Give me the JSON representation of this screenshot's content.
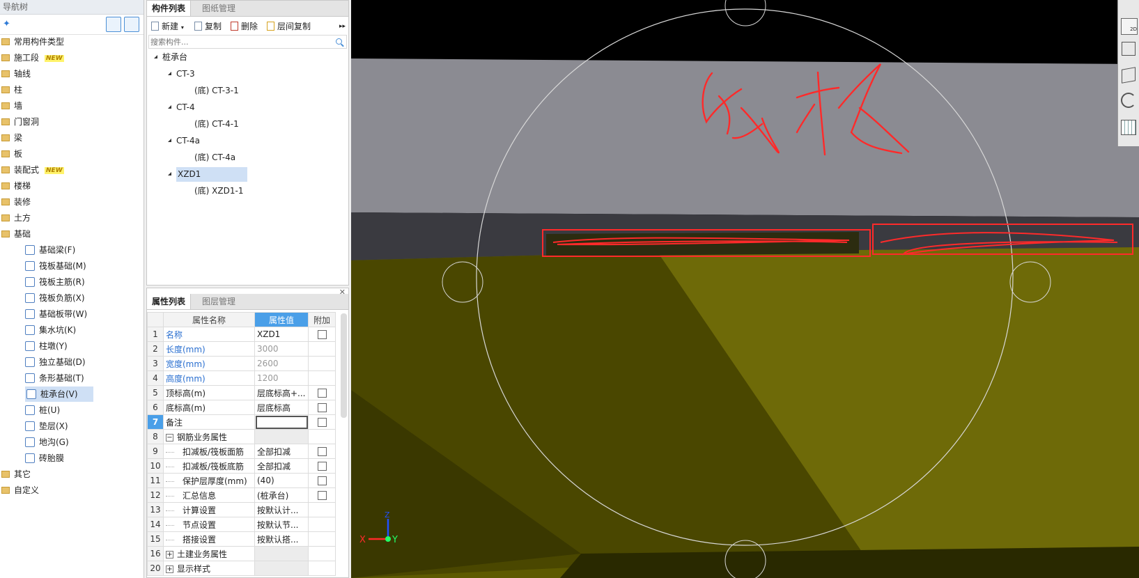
{
  "nav": {
    "title": "导航树",
    "new_badge": "NEW",
    "items": [
      {
        "label": "常用构件类型",
        "new": false
      },
      {
        "label": "施工段",
        "new": true
      },
      {
        "label": "轴线",
        "new": false
      },
      {
        "label": "柱",
        "new": false
      },
      {
        "label": "墙",
        "new": false
      },
      {
        "label": "门窗洞",
        "new": false
      },
      {
        "label": "梁",
        "new": false
      },
      {
        "label": "板",
        "new": false
      },
      {
        "label": "装配式",
        "new": true
      },
      {
        "label": "楼梯",
        "new": false
      },
      {
        "label": "装修",
        "new": false
      },
      {
        "label": "土方",
        "new": false
      },
      {
        "label": "基础",
        "new": false
      }
    ],
    "foundation_children": [
      "基础梁(F)",
      "筏板基础(M)",
      "筏板主筋(R)",
      "筏板负筋(X)",
      "基础板带(W)",
      "集水坑(K)",
      "柱墩(Y)",
      "独立基础(D)",
      "条形基础(T)",
      "桩承台(V)",
      "桩(U)",
      "垫层(X)",
      "地沟(G)",
      "砖胎膜"
    ],
    "tail_items": [
      "其它",
      "自定义"
    ]
  },
  "component_panel": {
    "tabs": [
      "构件列表",
      "图纸管理"
    ],
    "toolbar": {
      "new": "新建",
      "copy": "复制",
      "delete": "删除",
      "floor_copy": "层间复制"
    },
    "search_placeholder": "搜索构件...",
    "tree": {
      "root": "桩承台",
      "groups": [
        {
          "name": "CT-3",
          "child": "(底) CT-3-1"
        },
        {
          "name": "CT-4",
          "child": "(底) CT-4-1"
        },
        {
          "name": "CT-4a",
          "child": "(底) CT-4a"
        },
        {
          "name": "XZD1",
          "child": "(底) XZD1-1"
        }
      ]
    }
  },
  "property_panel": {
    "tabs": [
      "属性列表",
      "图层管理"
    ],
    "headers": {
      "name": "属性名称",
      "value": "属性值",
      "extra": "附加"
    },
    "rows": [
      {
        "no": "1",
        "name": "名称",
        "value": "XZD1",
        "blue": true
      },
      {
        "no": "2",
        "name": "长度(mm)",
        "value": "3000",
        "blue": true
      },
      {
        "no": "3",
        "name": "宽度(mm)",
        "value": "2600",
        "blue": true
      },
      {
        "no": "4",
        "name": "高度(mm)",
        "value": "1200",
        "blue": true
      },
      {
        "no": "5",
        "name": "顶标高(m)",
        "value": "层底标高+..."
      },
      {
        "no": "6",
        "name": "底标高(m)",
        "value": "层底标高"
      },
      {
        "no": "7",
        "name": "备注",
        "value": ""
      },
      {
        "no": "8",
        "name": "钢筋业务属性",
        "value": ""
      },
      {
        "no": "9",
        "name": "扣减板/筏板面筋",
        "value": "全部扣减"
      },
      {
        "no": "10",
        "name": "扣减板/筏板底筋",
        "value": "全部扣减"
      },
      {
        "no": "11",
        "name": "保护层厚度(mm)",
        "value": "(40)"
      },
      {
        "no": "12",
        "name": "汇总信息",
        "value": "(桩承台)"
      },
      {
        "no": "13",
        "name": "计算设置",
        "value": "按默认计..."
      },
      {
        "no": "14",
        "name": "节点设置",
        "value": "按默认节..."
      },
      {
        "no": "15",
        "name": "搭接设置",
        "value": "按默认搭..."
      },
      {
        "no": "16",
        "name": "土建业务属性",
        "value": ""
      },
      {
        "no": "20",
        "name": "显示样式",
        "value": ""
      }
    ]
  },
  "viewport": {
    "axis_x": "X",
    "axis_y": "Y",
    "axis_z": "Z",
    "view_label": "2D",
    "colors": {
      "grey_slab": "#8b8b92",
      "olive": "#5d5a00",
      "annotation": "#ff2a2a"
    }
  }
}
